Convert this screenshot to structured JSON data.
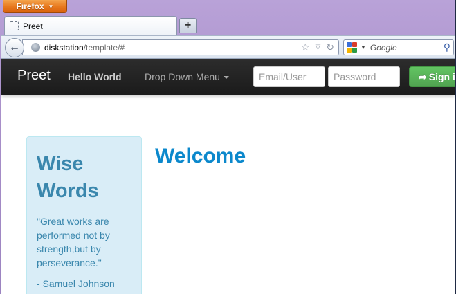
{
  "browser": {
    "menu_button_label": "Firefox",
    "tab_title": "Preet",
    "new_tab_label": "+",
    "url_host": "diskstation",
    "url_path": "/template/#",
    "search_placeholder": "Google"
  },
  "site": {
    "brand": "Preet",
    "nav_items": [
      {
        "label": "Hello World",
        "active": true
      },
      {
        "label": "Drop Down Menu",
        "has_caret": true
      }
    ],
    "email_placeholder": "Email/User",
    "password_placeholder": "Password",
    "signin_label": "Sign i",
    "signin_icon": "share-arrow-icon"
  },
  "sidebar": {
    "title_line1": "Wise",
    "title_line2": "Words",
    "quote": "\"Great works are performed not by strength,but by perseverance.\"",
    "author": "- Samuel Johnson"
  },
  "main": {
    "heading": "Welcome"
  },
  "colors": {
    "navbar_bg": "#1b1b1b",
    "signin_green": "#51a351",
    "well_bg": "#d9edf7",
    "well_text": "#3a87ad",
    "heading_blue": "#0b88cc",
    "firefox_orange": "#e7771c"
  }
}
